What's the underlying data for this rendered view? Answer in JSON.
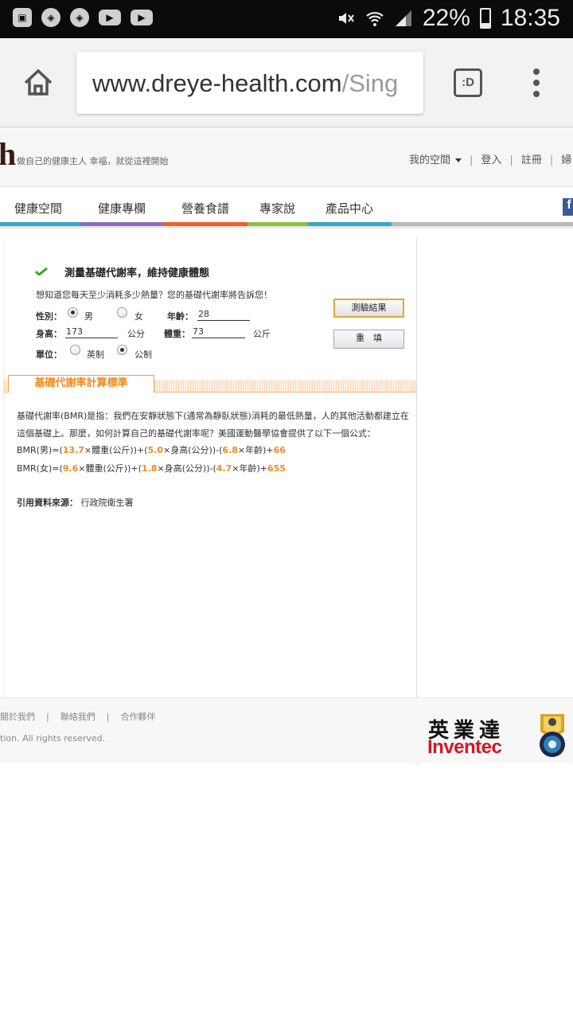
{
  "status_bar": {
    "battery": "22%",
    "time": "18:35"
  },
  "browser": {
    "url_main": "www.dreye-health.com",
    "url_rest": "/Sing",
    "tabs_icon_text": ":D"
  },
  "header": {
    "logo_letter": "h",
    "tagline": "做自己的健康主人 幸福，就從這裡開始",
    "links": [
      "我的空間",
      "登入",
      "註冊",
      "婦"
    ]
  },
  "nav": {
    "items": [
      "健康空間",
      "健康專欄",
      "營養食譜",
      "專家說",
      "產品中心"
    ],
    "facebook_letter": "f",
    "bar_colors": [
      "#34a9c8",
      "#8f6db1",
      "#e8632a",
      "#8cbf3f",
      "#34a9c8",
      "#b8b8b8"
    ]
  },
  "calculator": {
    "title": "測量基礎代謝率，維持健康體態",
    "subtitle": "想知道您每天至少消耗多少熱量？您的基礎代謝率將告訴您！",
    "gender_label": "性別：",
    "gender_male": "男",
    "gender_female": "女",
    "gender_selected": "男",
    "age_label": "年齡：",
    "age_value": "28",
    "height_label": "身高：",
    "height_value": "173",
    "height_unit": "公分",
    "weight_label": "體重：",
    "weight_value": "73",
    "weight_unit": "公斤",
    "unit_label": "單位：",
    "unit_imperial": "英制",
    "unit_metric": "公制",
    "unit_selected": "公制",
    "submit_label": "測驗結果",
    "reset_label": "重　填"
  },
  "standard": {
    "section_title": "基礎代謝率計算標準",
    "paragraph": "基礎代謝率(BMR)是指：我們在安靜狀態下(通常為靜臥狀態)消耗的最低熱量，人的其他活動都建立在這個基礎上。那麼，如何計算自己的基礎代謝率呢？美國運動醫學協會提供了以下一個公式：",
    "male": {
      "prefix": "BMR(男)=(",
      "c1": "13.7",
      "t1": "×體重(公斤))+(",
      "c2": "5.0",
      "t2": "×身高(公分))-(",
      "c3": "6.8",
      "t3": "×年齡)+",
      "c4": "66"
    },
    "female": {
      "prefix": "BMR(女)=(",
      "c1": "9.6",
      "t1": "×體重(公斤))+(",
      "c2": "1.8",
      "t2": "×身高(公分))-(",
      "c3": "4.7",
      "t3": "×年齡)+",
      "c4": "655"
    },
    "source_label": "引用資料來源：",
    "source_value": "行政院衛生署"
  },
  "footer": {
    "links": [
      "關於我們",
      "聯絡我們",
      "合作夥伴"
    ],
    "copyright": "tion. All rights reserved.",
    "logo_cn": "英業達",
    "logo_en": "Inventec"
  }
}
